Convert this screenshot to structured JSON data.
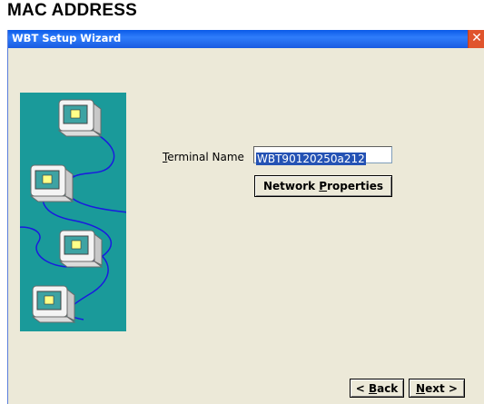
{
  "heading": "MAC ADDRESS",
  "window": {
    "title": "WBT Setup Wizard",
    "close_glyph": "✕"
  },
  "form": {
    "terminal_name_label_prefix": "",
    "terminal_name_label_accel": "T",
    "terminal_name_label_rest": "erminal Name",
    "terminal_name_value": "WBT90120250a212"
  },
  "buttons": {
    "network_pre": "Network ",
    "network_accel": "P",
    "network_post": "roperties",
    "back_pre": "< ",
    "back_accel": "B",
    "back_post": "ack",
    "next_accel": "N",
    "next_post": "ext >"
  },
  "colors": {
    "illustration_bg": "#1a9a9a",
    "titlebar": "#1a5be0",
    "selection": "#2452b4",
    "close": "#e0542c"
  },
  "icons": [
    "computer-icon",
    "computer-icon",
    "computer-icon",
    "computer-icon",
    "network-cable-icon",
    "close-icon"
  ]
}
